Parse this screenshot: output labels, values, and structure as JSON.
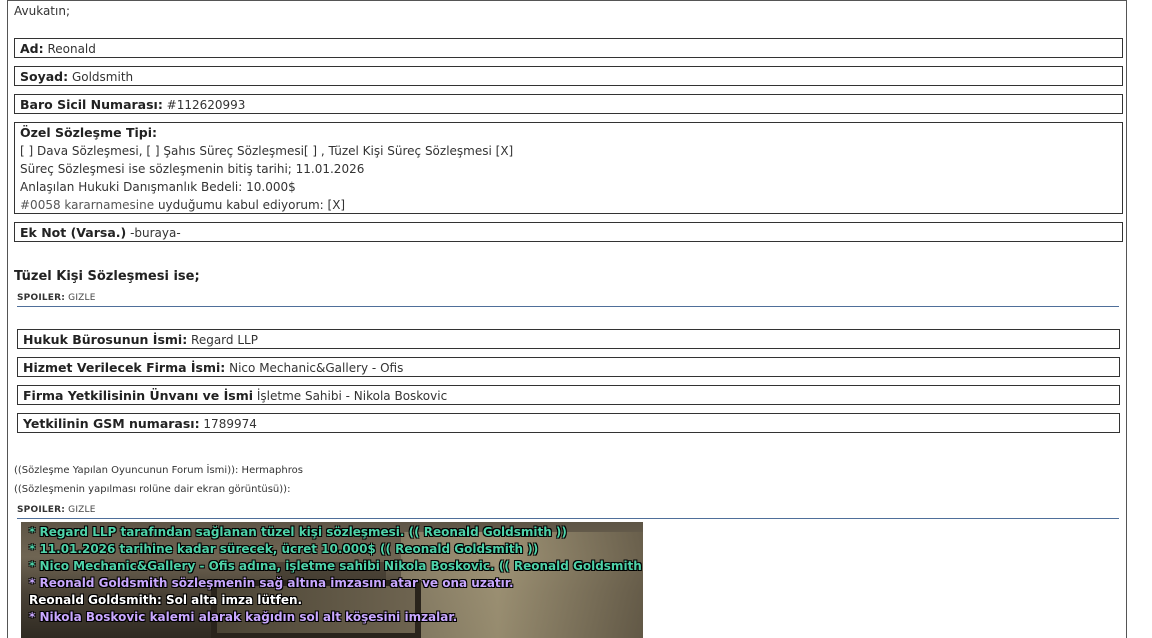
{
  "intro": "Avukatın;",
  "fields": {
    "ad": {
      "label": "Ad:",
      "value": "Reonald"
    },
    "soyad": {
      "label": "Soyad:",
      "value": "Goldsmith"
    },
    "baro": {
      "label": "Baro Sicil Numarası:",
      "value": "#112620993"
    },
    "ek_not": {
      "label": "Ek Not (Varsa.)",
      "value": "-buraya-"
    }
  },
  "ozel": {
    "label": "Özel Sözleşme Tipi:",
    "lines": [
      "[ ] Dava Sözleşmesi, [ ] Şahıs Süreç Sözleşmesi[ ] , Tüzel Kişi Süreç Sözleşmesi [X]",
      "Süreç Sözleşmesi ise sözleşmenin bitiş tarihi; 11.01.2026",
      "Anlaşılan Hukuki Danışmanlık Bedeli: 10.000$"
    ],
    "karar_link": "#0058 kararnamesine",
    "karar_rest": " uyduğumu kabul ediyorum: [X]"
  },
  "tuzel_heading": "Tüzel Kişi Sözleşmesi ise;",
  "spoiler": {
    "label": "SPOILER:",
    "toggle": "GIZLE"
  },
  "tuzel": {
    "buro": {
      "label": "Hukuk Bürosunun İsmi:",
      "value": "Regard LLP"
    },
    "firma": {
      "label": "Hizmet Verilecek Firma İsmi:",
      "value": "Nico Mechanic&Gallery - Ofis"
    },
    "yetkili": {
      "label": "Firma Yetkilisinin Ünvanı ve İsmi",
      "value": "İşletme Sahibi - Nikola Boskovic"
    },
    "gsm": {
      "label": "Yetkilinin GSM numarası:",
      "value": "1789974"
    }
  },
  "forum_line": "((Sözleşme Yapılan Oyuncunun Forum İsmi)): Hermaphros",
  "screenshot_line": "((Sözleşmenin yapılması rolüne dair ekran görüntüsü)):",
  "chat": [
    "* Regard LLP tarafından sağlanan tüzel kişi sözleşmesi. (( Reonald Goldsmith ))",
    "* 11.01.2026 tarihine kadar sürecek, ücret 10.000$ (( Reonald Goldsmith ))",
    "* Nico Mechanic&Gallery - Ofis adına, işletme sahibi Nikola Boskovic. (( Reonald Goldsmith ))",
    "* Reonald Goldsmith sözleşmenin sağ altına imzasını atar ve ona uzatır.",
    "Reonald Goldsmith: Sol alta imza lütfen.",
    "* Nikola Boskovic kalemi alarak kağıdın sol alt köşesini imzalar."
  ],
  "colors": {
    "link": "#555555",
    "spoiler_rule": "#4f6f9a",
    "chat_green": "#4fd3a9",
    "chat_purple": "#c9a8ff"
  }
}
